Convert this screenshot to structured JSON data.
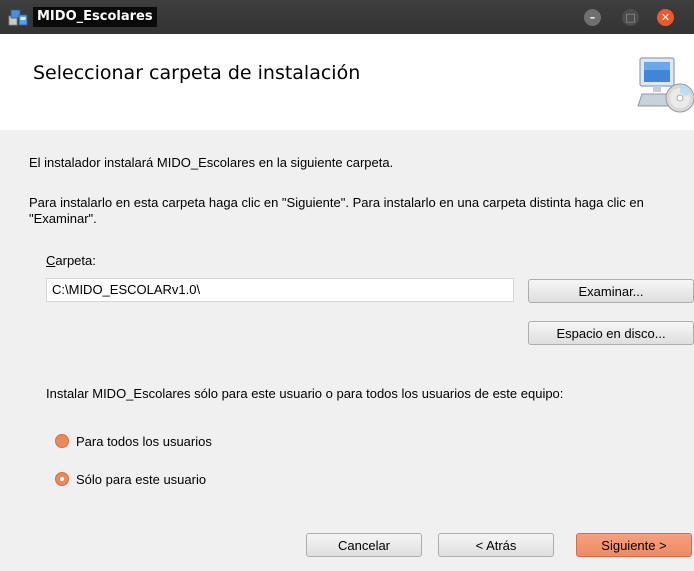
{
  "window": {
    "title": "MIDO_Escolares",
    "controls": {
      "minimize_icon": "minimize-icon",
      "maximize_icon": "maximize-icon",
      "close_icon": "close-icon"
    }
  },
  "header": {
    "title": "Seleccionar carpeta de instalación",
    "icon": "computer-disc-icon"
  },
  "body": {
    "intro": "El instalador instalará MIDO_Escolares en la siguiente carpeta.",
    "instructions": "Para instalarlo en esta carpeta haga clic en \"Siguiente\". Para instalarlo en una carpeta distinta haga clic en \"Examinar\".",
    "folder_label_accel": "C",
    "folder_label_rest": "arpeta:",
    "folder_value": "C:\\MIDO_ESCOLARv1.0\\",
    "browse_label": "Examinar...",
    "disk_space_label": "Espacio en disco...",
    "install_for_text": "Instalar MIDO_Escolares sólo para este usuario o para todos los usuarios de este equipo:",
    "radio_options": [
      {
        "label": "Para todos los usuarios",
        "selected": false
      },
      {
        "label": "Sólo para este usuario",
        "selected": true
      }
    ]
  },
  "footer": {
    "cancel_label": "Cancelar",
    "back_label": "< Atrás",
    "next_label": "Siguiente >"
  },
  "colors": {
    "accent": "#ee8a65",
    "titlebar": "#333333",
    "close_button": "#ec5a2b"
  }
}
